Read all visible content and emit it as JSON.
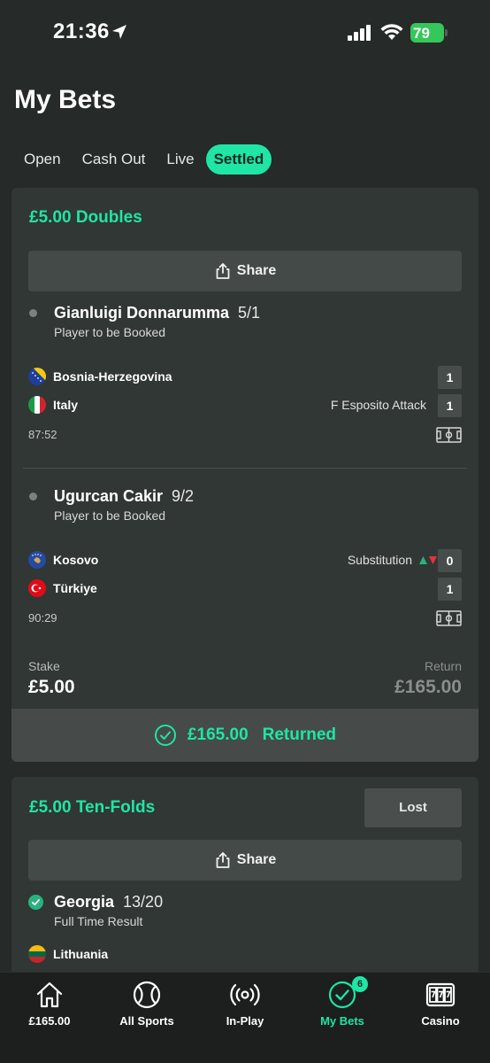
{
  "status_bar": {
    "time": "21:36",
    "battery": "79"
  },
  "page": {
    "title": "My Bets"
  },
  "tabs": [
    {
      "label": "Open",
      "active": false
    },
    {
      "label": "Cash Out",
      "active": false
    },
    {
      "label": "Live",
      "active": false
    },
    {
      "label": "Settled",
      "active": true
    }
  ],
  "bets": [
    {
      "type": "£5.00 Doubles",
      "share_label": "Share",
      "selections": [
        {
          "name": "Gianluigi Donnarumma",
          "odds": "5/1",
          "market": "Player to be Booked",
          "teams": [
            {
              "name": "Bosnia-Herzegovina",
              "score": "1",
              "event": ""
            },
            {
              "name": "Italy",
              "score": "1",
              "event": "F Esposito Attack"
            }
          ],
          "match_time": "87:52"
        },
        {
          "name": "Ugurcan Cakir",
          "odds": "9/2",
          "market": "Player to be Booked",
          "teams": [
            {
              "name": "Kosovo",
              "score": "0",
              "event": "Substitution"
            },
            {
              "name": "Türkiye",
              "score": "1",
              "event": ""
            }
          ],
          "match_time": "90:29"
        }
      ],
      "stake_label": "Stake",
      "stake": "£5.00",
      "return_label": "Return",
      "return": "£165.00",
      "returned_amount": "£165.00",
      "returned_label": "Returned"
    },
    {
      "type": "£5.00 Ten-Folds",
      "status": "Lost",
      "share_label": "Share",
      "selections": [
        {
          "name": "Georgia",
          "odds": "13/20",
          "market": "Full Time Result",
          "teams": [
            {
              "name": "Lithuania"
            }
          ]
        }
      ]
    }
  ],
  "bottom_nav": [
    {
      "label": "£165.00",
      "icon": "home-icon"
    },
    {
      "label": "All Sports",
      "icon": "ball-icon"
    },
    {
      "label": "In-Play",
      "icon": "broadcast-icon"
    },
    {
      "label": "My Bets",
      "icon": "check-circle-icon",
      "badge": "6",
      "active": true
    },
    {
      "label": "Casino",
      "icon": "slot-machine-icon"
    }
  ],
  "colors": {
    "accent": "#1fe5a5",
    "background": "#262a28",
    "card": "#313734"
  }
}
